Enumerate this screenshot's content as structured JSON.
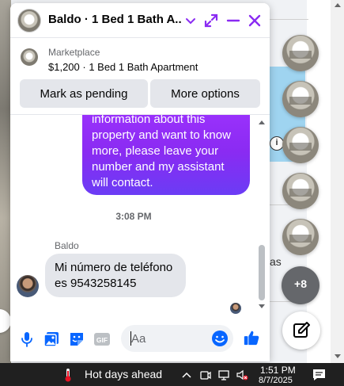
{
  "chat": {
    "title": "Baldo · 1 Bed 1 Bath A...",
    "marketplace_label": "Marketplace",
    "listing": "$1,200 · 1 Bed 1 Bath Apartment",
    "buttons": {
      "pending": "Mark as pending",
      "more": "More options"
    },
    "outgoing_message": "information about this property and want to know more, please leave your number and my assistant will contact.",
    "timestamp": "3:08 PM",
    "sender_name": "Baldo",
    "incoming_message": "Mi número de teléfono es 9543258145",
    "composer_placeholder": "Aa",
    "accent_color": "#8a2bf2",
    "icon_color": "#0866ff"
  },
  "background": {
    "partial_text": "as",
    "more_chats_badge": "+8"
  },
  "taskbar": {
    "weather": "Hot days ahead",
    "time": "1:51 PM",
    "date": "8/7/2025"
  }
}
